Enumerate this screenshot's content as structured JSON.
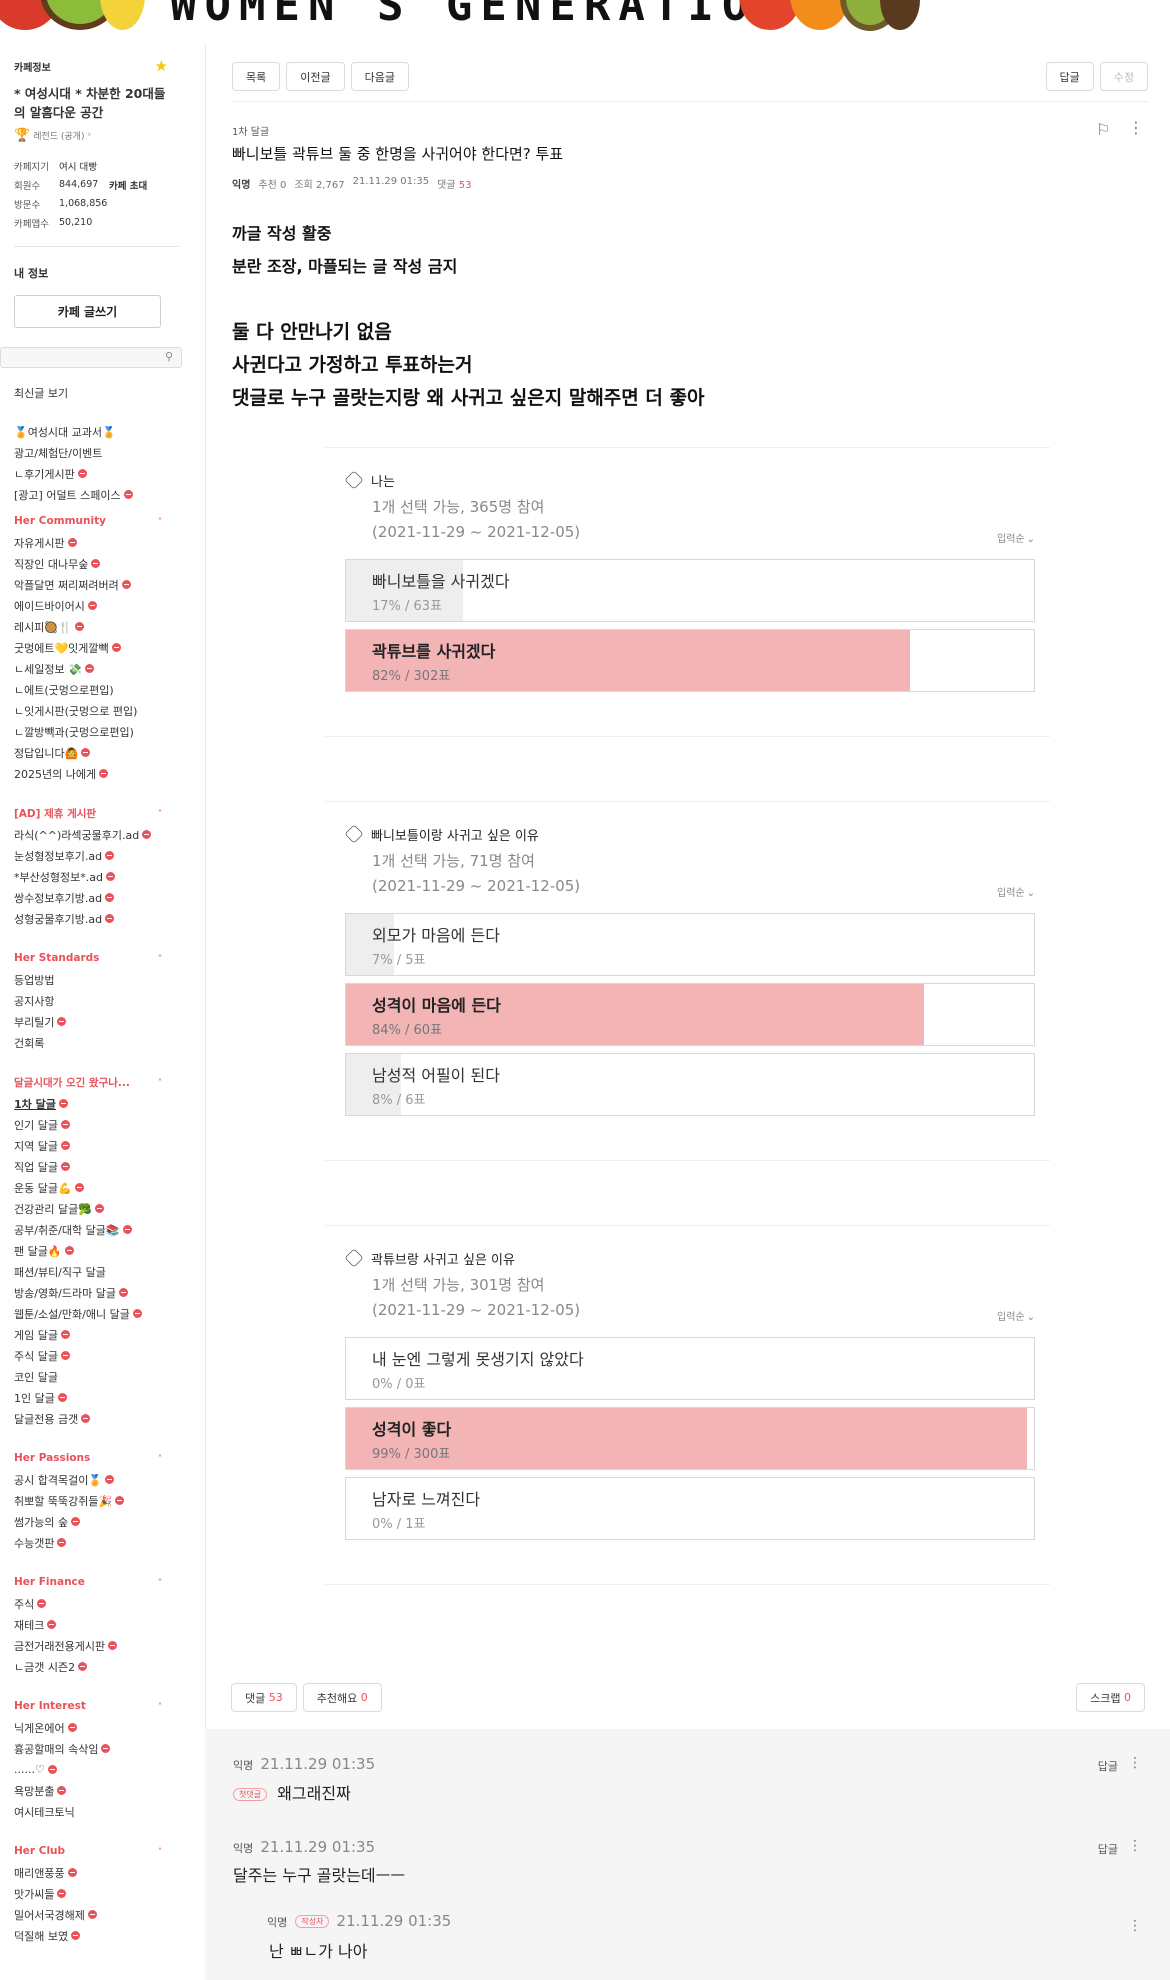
{
  "banner": {
    "title": "WOMEN'S GENERATION"
  },
  "sidebar": {
    "cafe_info_label": "카페정보",
    "cafe_name": "* 여성시대 * 차분한 20대들의 알흠다운 공간",
    "grade": "레전드 (공개)",
    "stats": [
      {
        "label": "카페지기",
        "value": "여시 대빵"
      },
      {
        "label": "회원수",
        "value": "844,697",
        "extra": "카페 초대"
      },
      {
        "label": "방문수",
        "value": "1,068,856"
      },
      {
        "label": "카페앱수",
        "value": "50,210"
      }
    ],
    "my_info": "내 정보",
    "write_button": "카페 글쓰기",
    "search_placeholder": "",
    "recent": "최신글 보기",
    "top_items": [
      {
        "label": "🏅여성시대 교과서🏅",
        "dot": false
      },
      {
        "label": "광고/체험단/이벤트",
        "dot": false
      },
      {
        "label": "ㄴ후기게시판",
        "dot": true
      },
      {
        "label": "[광고] 어덜트 스페이스",
        "dot": true
      }
    ],
    "categories": [
      {
        "name": "Her Community",
        "items": [
          {
            "label": "자유게시판",
            "dot": true
          },
          {
            "label": "직장인 대나무숲",
            "dot": true
          },
          {
            "label": "악플달면 쩌리쩌려버려",
            "dot": true
          },
          {
            "label": "에이드바이어시",
            "dot": true
          },
          {
            "label": "레시피🥘🍴",
            "dot": true
          },
          {
            "label": "굿멍에트💛잇게깔빽",
            "dot": true
          },
          {
            "label": "ㄴ세일정보 💸",
            "dot": true
          },
          {
            "label": "ㄴ에트(굿멍으로편입)",
            "dot": false
          },
          {
            "label": "ㄴ잇게시판(굿멍으로 편입)",
            "dot": false
          },
          {
            "label": "ㄴ깔방빽과(굿멍으로편입)",
            "dot": false
          },
          {
            "label": "정답입니다🙆",
            "dot": true
          },
          {
            "label": "2025년의 나에게",
            "dot": true
          }
        ]
      },
      {
        "name": "[AD] 제휴 게시판",
        "items": [
          {
            "label": "라식(^^)라섹궁물후기.ad",
            "dot": true
          },
          {
            "label": "눈성형정보후기.ad",
            "dot": true
          },
          {
            "label": "*부산성형정보*.ad",
            "dot": true
          },
          {
            "label": "쌍수정보후기방.ad",
            "dot": true
          },
          {
            "label": "성형궁물후기방.ad",
            "dot": true
          }
        ]
      },
      {
        "name": "Her Standards",
        "items": [
          {
            "label": "등업방법",
            "dot": false
          },
          {
            "label": "공지사항",
            "dot": false
          },
          {
            "label": "부리틸기",
            "dot": true
          },
          {
            "label": "건회록",
            "dot": false
          }
        ]
      },
      {
        "name": "달글시대가 오긴 왔구나...",
        "items": [
          {
            "label": "1차 달글",
            "dot": true,
            "active": true
          },
          {
            "label": "인기 달글",
            "dot": true
          },
          {
            "label": "지역 달글",
            "dot": true
          },
          {
            "label": "직업 달글",
            "dot": true
          },
          {
            "label": "운동 달글💪",
            "dot": true
          },
          {
            "label": "건강관리 달글🥦",
            "dot": true
          },
          {
            "label": "공부/취준/대학 달글📚",
            "dot": true
          },
          {
            "label": "팬 달글🔥",
            "dot": true
          },
          {
            "label": "패션/뷰티/직구 달글",
            "dot": false
          },
          {
            "label": "방송/영화/드라마 달글",
            "dot": true
          },
          {
            "label": "웹툰/소설/만화/애니 달글",
            "dot": true
          },
          {
            "label": "게임 달글",
            "dot": true
          },
          {
            "label": "주식 달글",
            "dot": true
          },
          {
            "label": "코인 달글",
            "dot": false
          },
          {
            "label": "1인 달글",
            "dot": true
          },
          {
            "label": "달글전용 금갯",
            "dot": true
          }
        ]
      },
      {
        "name": "Her Passions",
        "items": [
          {
            "label": "공시 합격목걸이🏅",
            "dot": true
          },
          {
            "label": "취뽀할 뚝뚝강쥐들🎉",
            "dot": true
          },
          {
            "label": "썸가능의 숲",
            "dot": true
          },
          {
            "label": "수능갯판",
            "dot": true
          }
        ]
      },
      {
        "name": "Her Finance",
        "items": [
          {
            "label": "주식",
            "dot": true
          },
          {
            "label": "재테크",
            "dot": true
          },
          {
            "label": "금전거래전용게시판",
            "dot": true
          },
          {
            "label": "ㄴ금갯 시즌2",
            "dot": true
          }
        ]
      },
      {
        "name": "Her Interest",
        "items": [
          {
            "label": "닉게온에어",
            "dot": true
          },
          {
            "label": "흉공할매의 속삭임",
            "dot": true
          },
          {
            "label": "......♡",
            "dot": true
          },
          {
            "label": "욕망분출",
            "dot": true
          },
          {
            "label": "여시테크토닉",
            "dot": false
          }
        ]
      },
      {
        "name": "Her Club",
        "items": [
          {
            "label": "매리앤풍풍",
            "dot": true
          },
          {
            "label": "맛가씨들",
            "dot": true
          },
          {
            "label": "밀어서국경해제",
            "dot": true
          },
          {
            "label": "덕질해 보였",
            "dot": true
          }
        ]
      }
    ]
  },
  "toolbar": {
    "list": "목록",
    "prev": "이전글",
    "next": "다음글",
    "reply": "답글",
    "edit": "수정"
  },
  "post": {
    "board": "1차 달글",
    "title": "빠니보틀 곽튜브 둘 중 한명을 사귀어야 한다면? 투표",
    "author": "익명",
    "recommend": "추천 0",
    "views": "조회 2,767",
    "date": "21.11.29 01:35",
    "comment_label": "댓글",
    "comment_count": "53",
    "body": [
      {
        "text": "까글 작성 활중",
        "size": "m"
      },
      {
        "text": "분란 조장, 마플되는 글 작성 금지",
        "size": "m"
      },
      {
        "text": "",
        "size": "m"
      },
      {
        "text": "둘 다 안만나기 없음",
        "size": "l"
      },
      {
        "text": "사귄다고 가정하고 투표하는거",
        "size": "l"
      },
      {
        "text": "댓글로 누구 골랏는지랑 왜 사귀고 싶은지 말해주면 더 좋아",
        "size": "l"
      }
    ]
  },
  "votes": [
    {
      "question": "나는",
      "meta1": "1개 선택 가능, 365명 참여",
      "meta2": "(2021-11-29 ~ 2021-12-05)",
      "sort": "입력순",
      "options": [
        {
          "label": "빠니보틀을 사귀겠다",
          "count": "17% / 63표",
          "pct": 17,
          "best": false
        },
        {
          "label": "곽튜브를 사귀겠다",
          "count": "82% / 302표",
          "pct": 82,
          "best": true
        }
      ]
    },
    {
      "question": "빠니보틀이랑 사귀고 싶은 이유",
      "meta1": "1개 선택 가능, 71명 참여",
      "meta2": "(2021-11-29 ~ 2021-12-05)",
      "sort": "입력순",
      "options": [
        {
          "label": "외모가 마음에 든다",
          "count": "7% / 5표",
          "pct": 7,
          "best": false
        },
        {
          "label": "성격이 마음에 든다",
          "count": "84% / 60표",
          "pct": 84,
          "best": true
        },
        {
          "label": "남성적 어필이 된다",
          "count": "8% / 6표",
          "pct": 8,
          "best": false
        }
      ]
    },
    {
      "question": "곽튜브랑 사귀고 싶은 이유",
      "meta1": "1개 선택 가능, 301명 참여",
      "meta2": "(2021-11-29 ~ 2021-12-05)",
      "sort": "입력순",
      "options": [
        {
          "label": "내 눈엔 그렇게 못생기지 않았다",
          "count": "0% / 0표",
          "pct": 0,
          "best": false
        },
        {
          "label": "성격이 좋다",
          "count": "99% / 300표",
          "pct": 99,
          "best": true
        },
        {
          "label": "남자로 느껴진다",
          "count": "0% / 1표",
          "pct": 0,
          "best": false
        }
      ]
    }
  ],
  "footer": {
    "comment": "댓글",
    "comment_count": "53",
    "recommend": "추천해요",
    "recommend_count": "0",
    "scrap": "스크랩",
    "scrap_count": "0"
  },
  "comments": [
    {
      "nick": "익명",
      "date": "21.11.29 01:35",
      "tag": "첫댓글",
      "text": "왜그래진짜",
      "reply": "답글"
    },
    {
      "nick": "익명",
      "date": "21.11.29 01:35",
      "tag": "",
      "text": "달주는 누구 골랏는데ㅡㅡ",
      "reply": "답글"
    },
    {
      "nick": "익명",
      "date": "21.11.29 01:35",
      "tag": "작성자",
      "text": "난 ㅃㄴ가 나아",
      "reply": ""
    }
  ],
  "colors": {
    "accent": "#e8525a",
    "vote_fill_best": "#f3b4b6",
    "vote_fill": "#eeeeee"
  }
}
